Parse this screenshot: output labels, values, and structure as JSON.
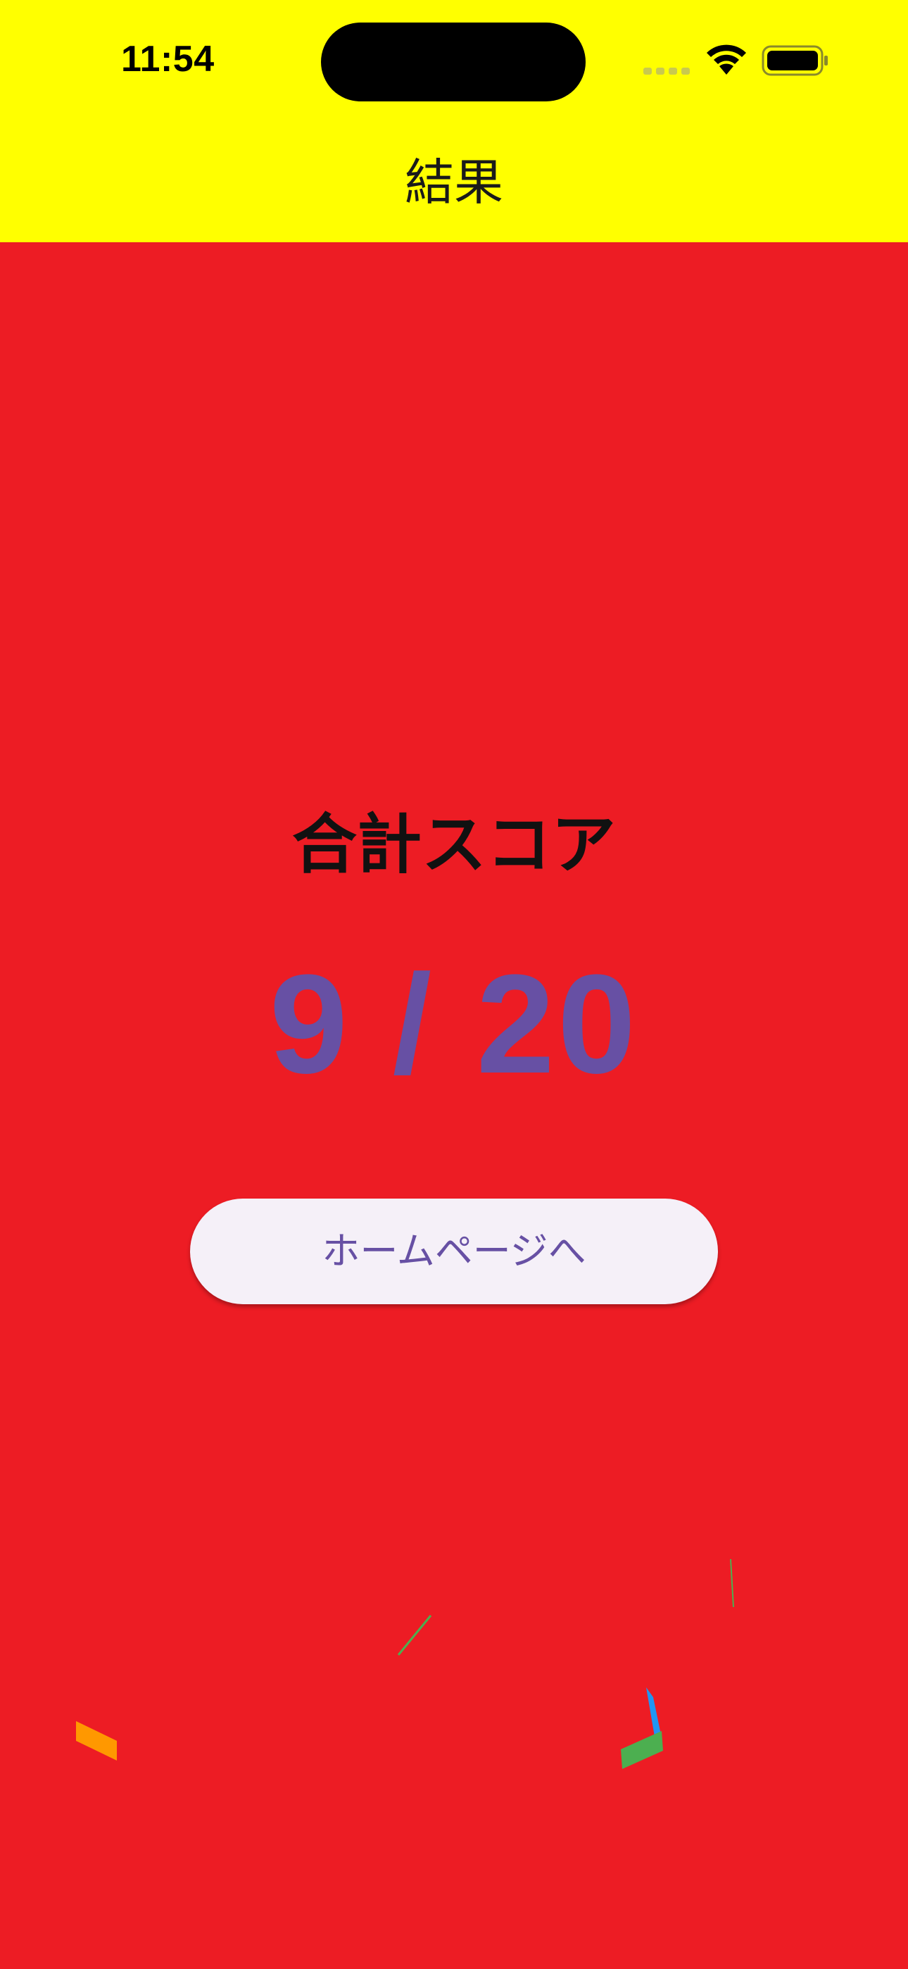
{
  "status_bar": {
    "time": "11:54"
  },
  "app_bar": {
    "title": "結果",
    "background": "#FFFF00"
  },
  "result": {
    "score_label": "合計スコア",
    "score_value": "9 / 20",
    "score": 9,
    "total": 20,
    "score_color": "#6750A4"
  },
  "actions": {
    "home_button_label": "ホームページへ"
  },
  "theme": {
    "page_background": "#ED1C24",
    "button_background": "#F5F0F8"
  },
  "confetti_colors": [
    "#FF9800",
    "#4CAF50",
    "#2196F3",
    "#8BC34A"
  ]
}
